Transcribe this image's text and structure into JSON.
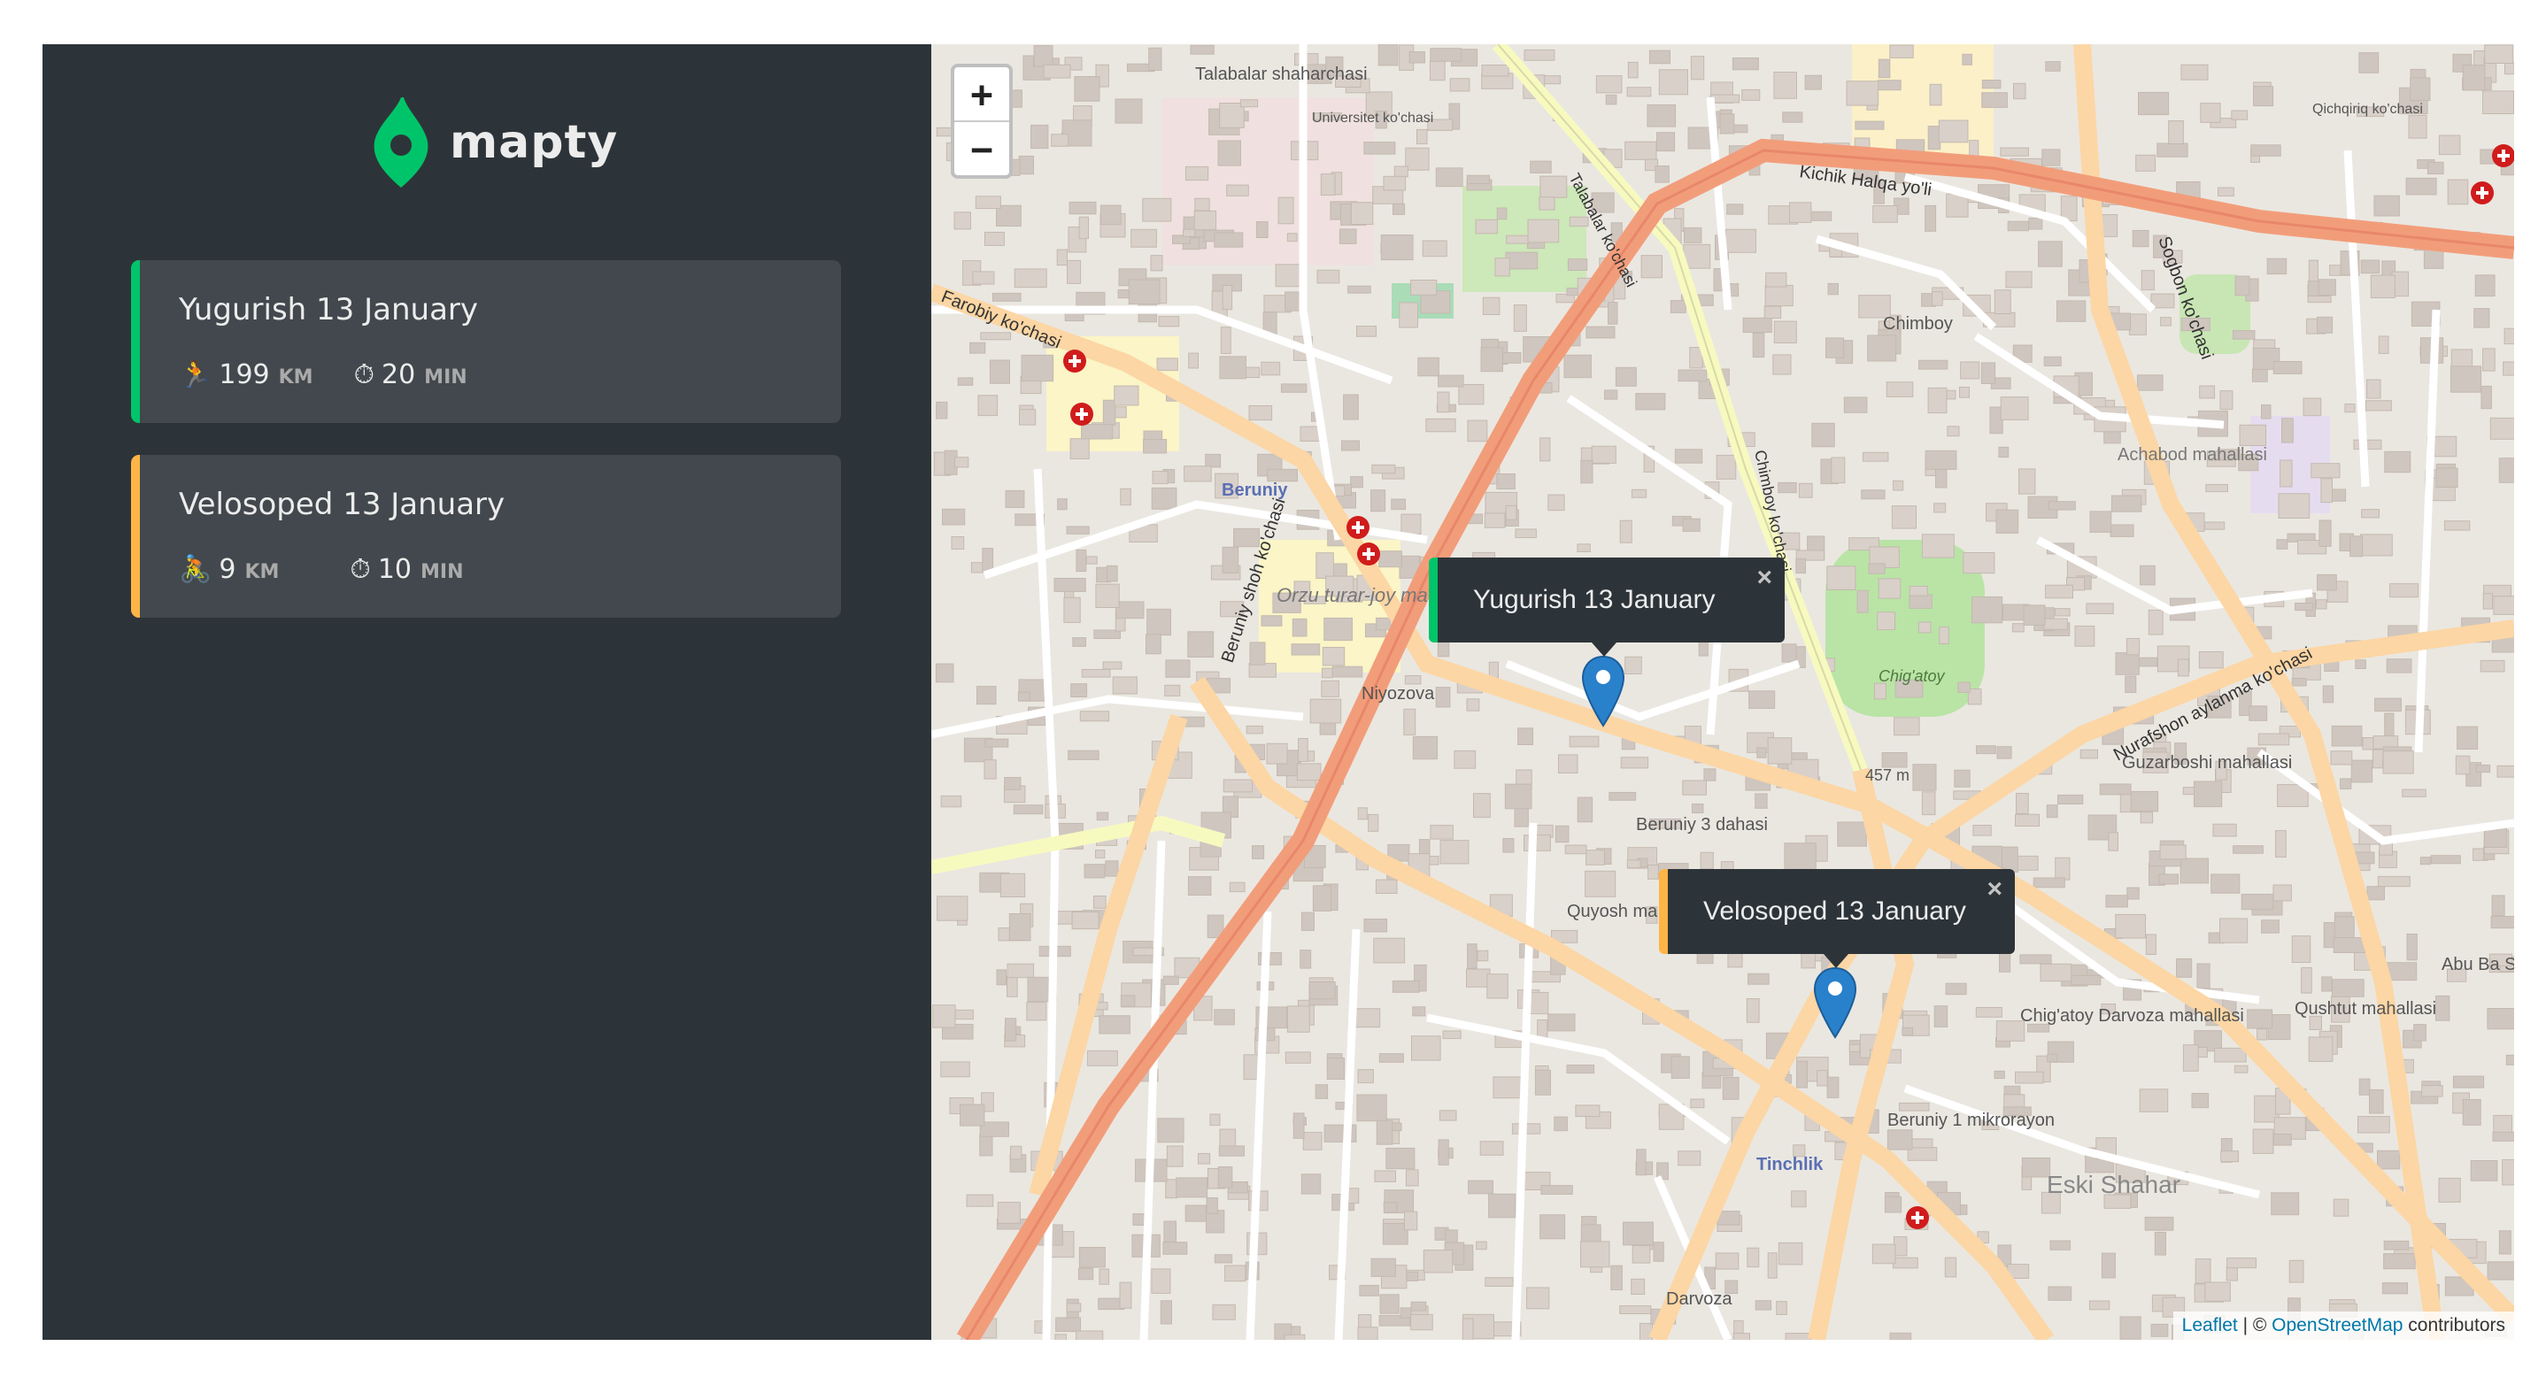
{
  "app": {
    "logo_text": "mapty"
  },
  "workouts": [
    {
      "title": "Yugurish 13 January",
      "type": "running",
      "accent": "#00c46a",
      "icon": "🏃",
      "distance_value": "199",
      "distance_unit": "KM",
      "duration_icon": "⏱",
      "duration_value": "20",
      "duration_unit": "MIN"
    },
    {
      "title": "Velosoped 13 January",
      "type": "cycling",
      "accent": "#ffb545",
      "icon": "🚴",
      "distance_value": "9",
      "distance_unit": "KM",
      "duration_icon": "⏱",
      "duration_value": "10",
      "duration_unit": "MIN"
    }
  ],
  "map": {
    "zoom_in": "+",
    "zoom_out": "−",
    "popups": [
      {
        "text": "Yugurish 13 January",
        "close": "×"
      },
      {
        "text": "Velosoped 13 January",
        "close": "×"
      }
    ],
    "marker_icon": "map-pin-icon",
    "attribution": {
      "leaflet": "Leaflet",
      "separator": " | © ",
      "osm": "OpenStreetMap",
      "suffix": " contributors"
    },
    "labels": [
      "Talabalar shaharchasi",
      "Universitet ko'chasi",
      "Kichik Halqa yo'li",
      "Qichqiriq ko'chasi",
      "Farobiy ko'chasi",
      "Talabalar ko'chasi",
      "Chimboy",
      "Chimboy ko'chasi",
      "Achabod mahallasi",
      "Beruniy",
      "Orzu turar-joy mavzesi",
      "Niyozova",
      "Chig'atoy",
      "Beruniy 3 dahasi",
      "Quyosh ma",
      "Guzarboshi mahallasi",
      "Nurafshon aylanma ko'chasi",
      "Qushtut mahallasi",
      "Chig'atoy Darvoza mahallasi",
      "Beruniy 1 mikrorayon",
      "Eski Shahar",
      "Tinchlik",
      "Darvoza",
      "Sogbon ko'chasi",
      "Abu Ba Shoshiy",
      "Beruniy shoh ko'chasi",
      "457 m"
    ],
    "colors": {
      "land": "#eae7e1",
      "major_road": "#f29d7a",
      "secondary_road": "#fcd6a4",
      "tertiary_road": "#f7fabf",
      "park": "#b9e4a6",
      "building": "#d9d0c9",
      "marker": "#2a81cb"
    }
  }
}
